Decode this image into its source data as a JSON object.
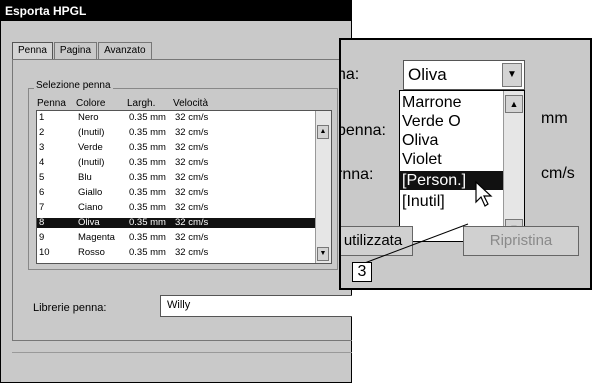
{
  "window": {
    "title": "Esporta HPGL"
  },
  "tabs": [
    {
      "label": "Penna"
    },
    {
      "label": "Pagina"
    },
    {
      "label": "Avanzato"
    }
  ],
  "pen_selection": {
    "group_label": "Selezione penna",
    "columns": [
      "Penna",
      "Colore",
      "Largh.",
      "Velocità"
    ],
    "rows": [
      {
        "pen": "1",
        "color": "Nero",
        "width": "0.35 mm",
        "speed": "32 cm/s"
      },
      {
        "pen": "2",
        "color": "(Inutil)",
        "width": "0.35 mm",
        "speed": "32 cm/s"
      },
      {
        "pen": "3",
        "color": "Verde",
        "width": "0.35 mm",
        "speed": "32 cm/s"
      },
      {
        "pen": "4",
        "color": "(Inutil)",
        "width": "0.35 mm",
        "speed": "32 cm/s"
      },
      {
        "pen": "5",
        "color": "Blu",
        "width": "0.35 mm",
        "speed": "32 cm/s"
      },
      {
        "pen": "6",
        "color": "Giallo",
        "width": "0.35 mm",
        "speed": "32 cm/s"
      },
      {
        "pen": "7",
        "color": "Ciano",
        "width": "0.35 mm",
        "speed": "32 cm/s"
      },
      {
        "pen": "8",
        "color": "Oliva",
        "width": "0.35 mm",
        "speed": "32 cm/s",
        "selected": true
      },
      {
        "pen": "9",
        "color": "Magenta",
        "width": "0.35 mm",
        "speed": "32 cm/s"
      },
      {
        "pen": "10",
        "color": "Rosso",
        "width": "0.35 mm",
        "speed": "32 cm/s"
      }
    ]
  },
  "pen_library": {
    "label": "Librerie penna:",
    "value": "Willy"
  },
  "zoom": {
    "label_color": "na:",
    "label_width": "penna:",
    "label_speed": "rnna:",
    "unit_mm": "mm",
    "unit_speed": "cm/s",
    "color_select_value": "Oliva",
    "color_options": [
      {
        "label": "Marrone"
      },
      {
        "label": "Verde O"
      },
      {
        "label": "Oliva"
      },
      {
        "label": "Violet"
      },
      {
        "label": "[Person.]",
        "selected": true
      },
      {
        "label": "[Inutil]"
      }
    ],
    "button_use": "utilizzata",
    "button_restore": "Ripristina",
    "callout_number": "3"
  },
  "colors": {
    "selection": "#111111",
    "dialog_bg": "#c9c9c9"
  }
}
